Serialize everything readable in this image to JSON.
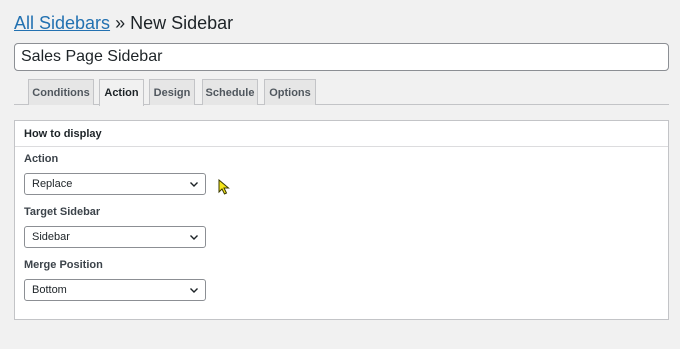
{
  "header": {
    "breadcrumb_link": "All Sidebars",
    "separator": "»",
    "page_title": "New Sidebar"
  },
  "title_field": {
    "value": "Sales Page Sidebar"
  },
  "tabs": [
    {
      "label": "Conditions"
    },
    {
      "label": "Action"
    },
    {
      "label": "Design"
    },
    {
      "label": "Schedule"
    },
    {
      "label": "Options"
    }
  ],
  "active_tab": "Action",
  "panel": {
    "heading": "How to display",
    "fields": [
      {
        "label": "Action",
        "selected": "Replace"
      },
      {
        "label": "Target Sidebar",
        "selected": "Sidebar"
      },
      {
        "label": "Merge Position",
        "selected": "Bottom"
      }
    ]
  },
  "colors": {
    "link": "#2271b1",
    "background": "#f1f1f1",
    "cursor": "#f5e61a"
  }
}
